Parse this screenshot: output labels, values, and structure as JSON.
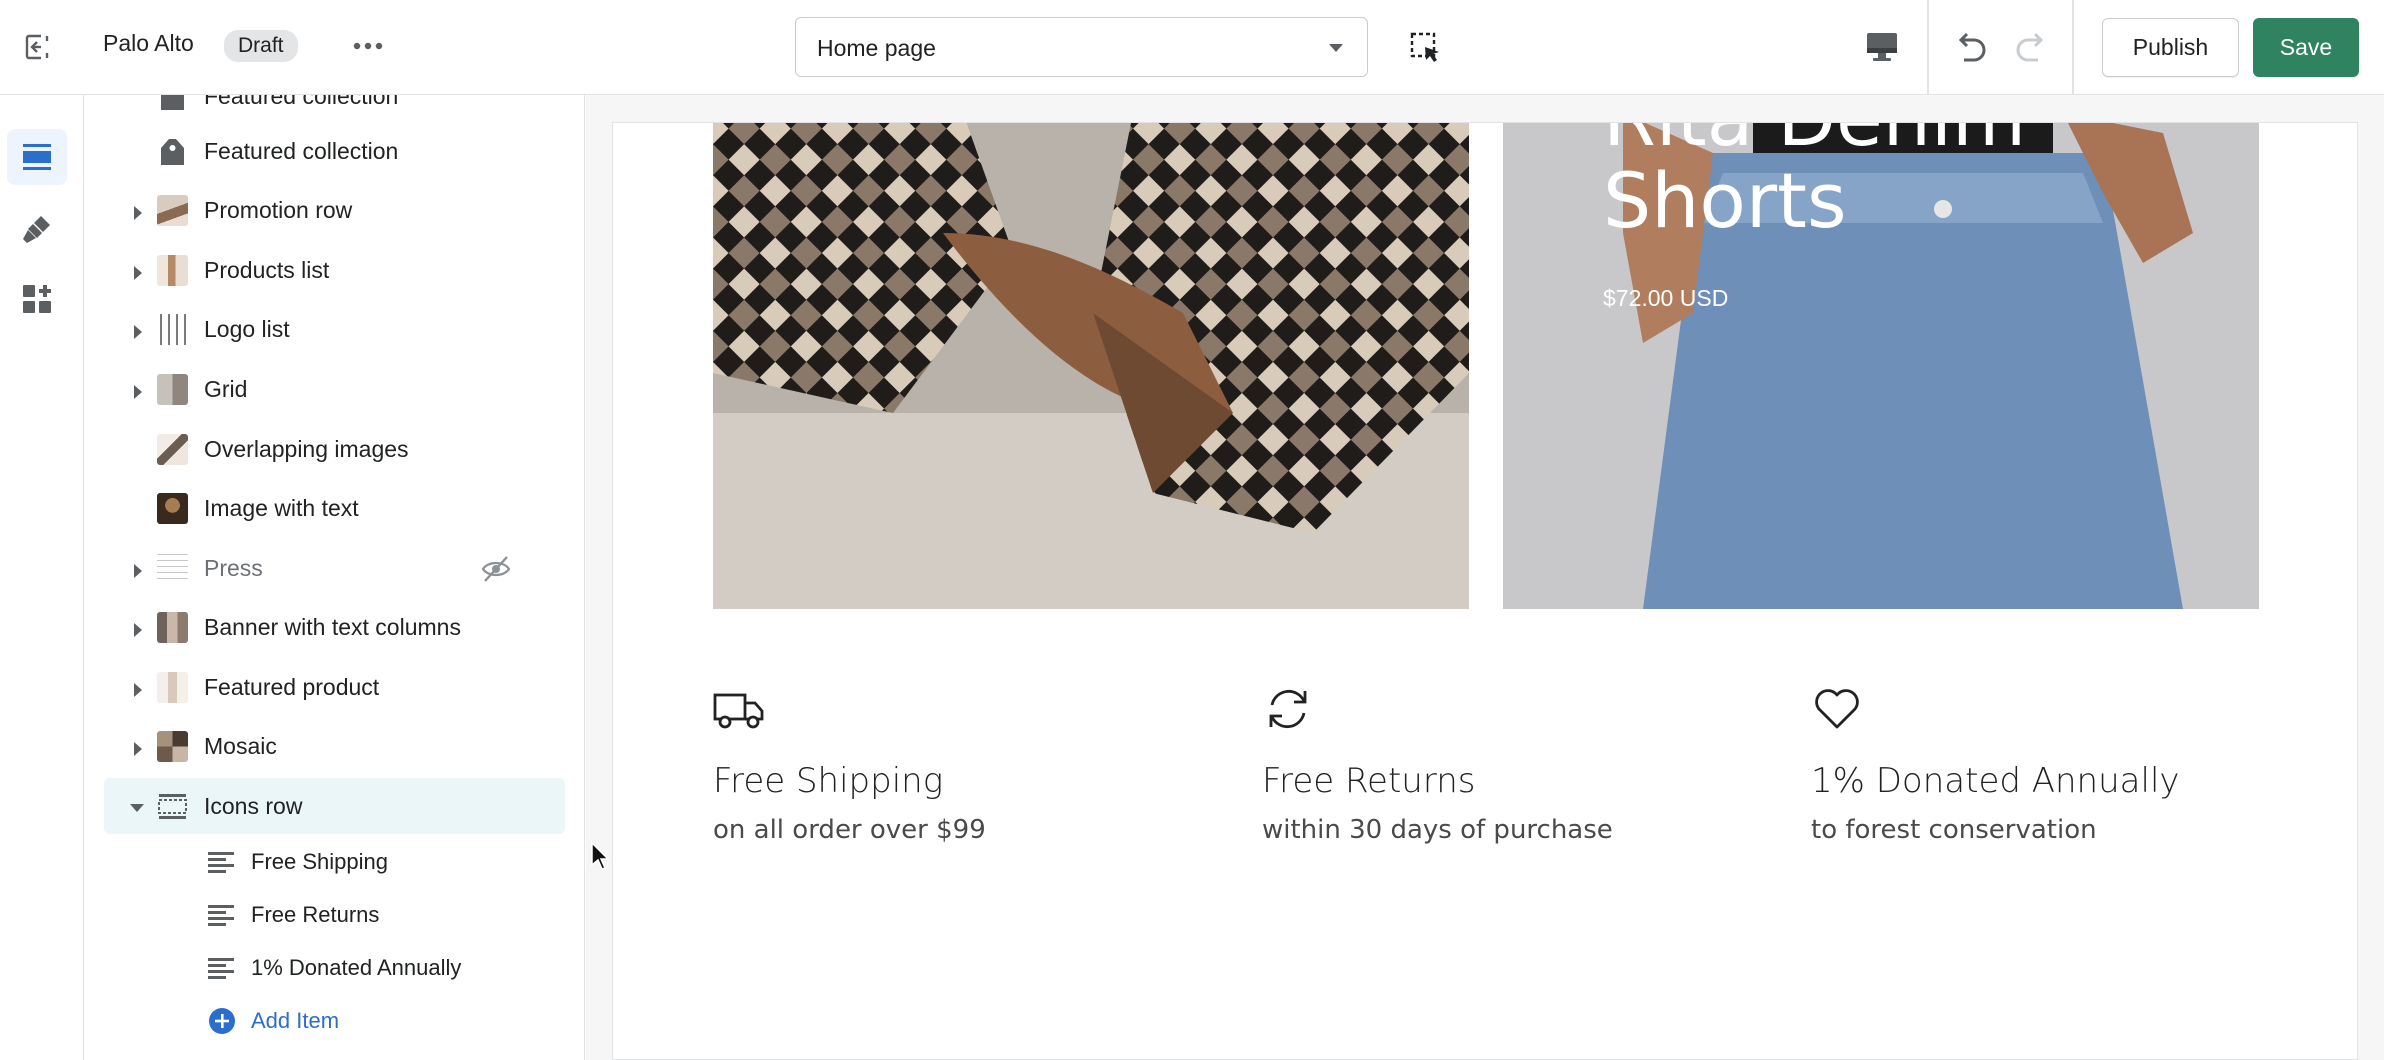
{
  "topbar": {
    "store_name": "Palo Alto",
    "status_badge": "Draft",
    "page_select": "Home page",
    "publish_label": "Publish",
    "save_label": "Save",
    "icons": [
      "exit-icon",
      "more-icon",
      "inspect-icon",
      "desktop-icon",
      "undo-icon",
      "redo-icon"
    ]
  },
  "rail": {
    "items": [
      "sections-icon",
      "theme-settings-icon",
      "apps-icon"
    ],
    "active": "sections-icon"
  },
  "sidebar": {
    "sections": [
      {
        "label": "Featured collection",
        "expandable": false
      },
      {
        "label": "Featured collection",
        "expandable": false
      },
      {
        "label": "Promotion row",
        "expandable": true
      },
      {
        "label": "Products list",
        "expandable": true
      },
      {
        "label": "Logo list",
        "expandable": true
      },
      {
        "label": "Grid",
        "expandable": true
      },
      {
        "label": "Overlapping images",
        "expandable": false
      },
      {
        "label": "Image with text",
        "expandable": false
      },
      {
        "label": "Press",
        "expandable": true,
        "hidden": true
      },
      {
        "label": "Banner with text columns",
        "expandable": true
      },
      {
        "label": "Featured product",
        "expandable": true
      },
      {
        "label": "Mosaic",
        "expandable": true
      },
      {
        "label": "Icons row",
        "expandable": true,
        "expanded": true,
        "selected": true
      }
    ],
    "icons_row_items": [
      {
        "label": "Free Shipping"
      },
      {
        "label": "Free Returns"
      },
      {
        "label": "1% Donated Annually"
      }
    ],
    "add_item_label": "Add Item"
  },
  "preview": {
    "product_title_partial": "Rita Denim",
    "product_title": "Shorts",
    "product_price": "$72.00 USD",
    "features": [
      {
        "icon": "truck-icon",
        "title": "Free Shipping",
        "text": "on all order over $99"
      },
      {
        "icon": "returns-icon",
        "title": "Free Returns",
        "text": "within 30 days of purchase"
      },
      {
        "icon": "heart-icon",
        "title": "1% Donated Annually",
        "text": "to forest conservation"
      }
    ]
  },
  "colors": {
    "save_button": "#2f8361",
    "selected_row": "#eaf6f8",
    "link": "#2c6ecb",
    "active_rail": "#edf4fd"
  }
}
